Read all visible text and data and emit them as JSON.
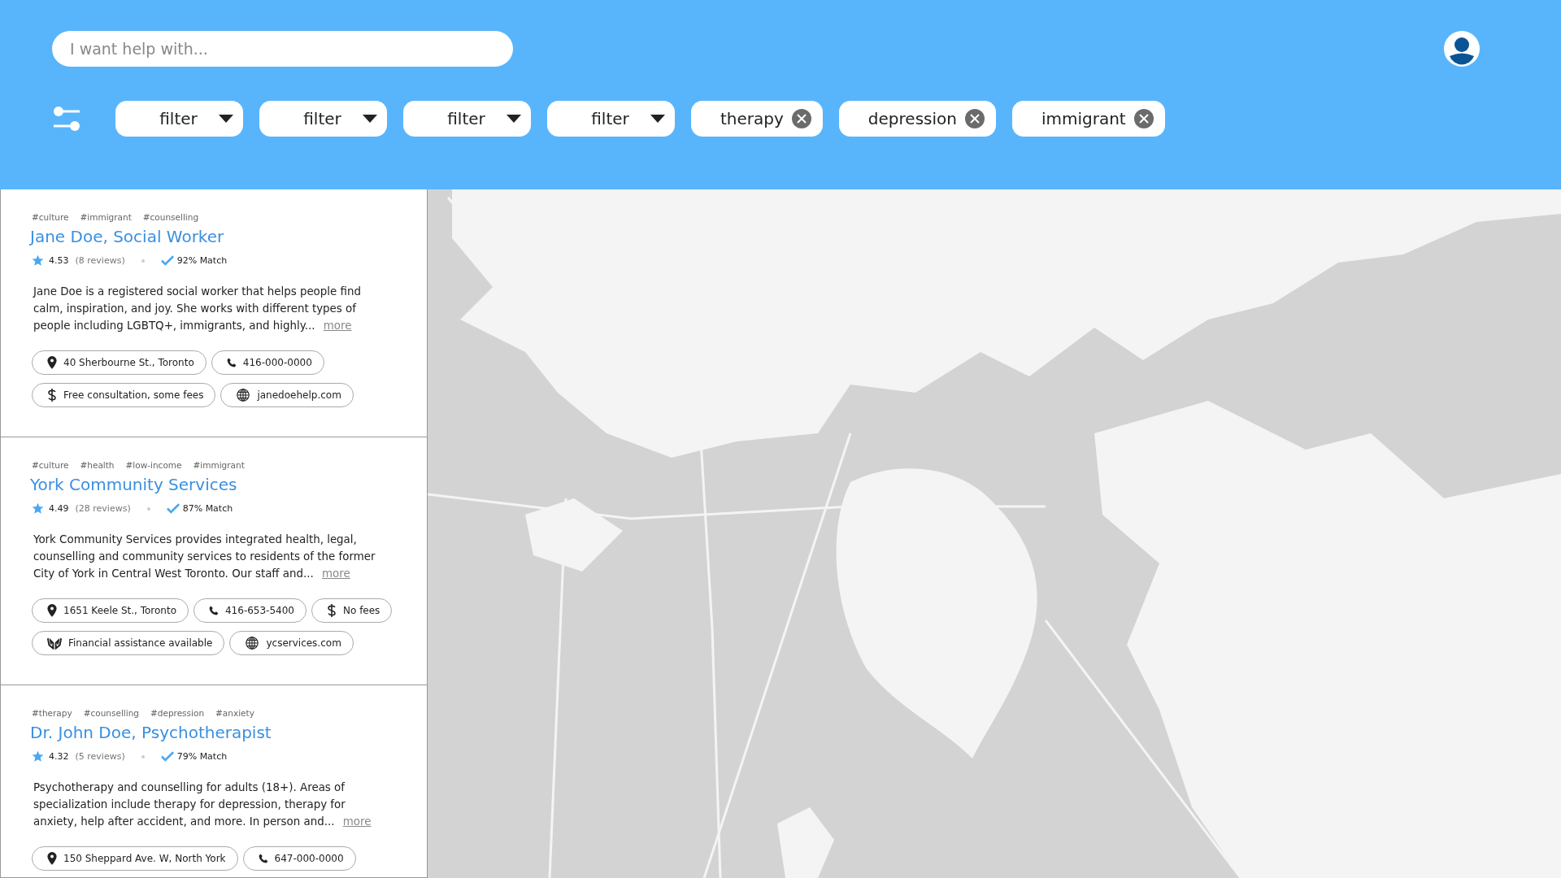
{
  "search": {
    "placeholder": "I want help with..."
  },
  "filters": [
    {
      "kind": "dropdown",
      "label": "filter"
    },
    {
      "kind": "dropdown",
      "label": "filter"
    },
    {
      "kind": "dropdown",
      "label": "filter"
    },
    {
      "kind": "dropdown",
      "label": "filter"
    },
    {
      "kind": "tag",
      "label": "therapy"
    },
    {
      "kind": "tag",
      "label": "depression"
    },
    {
      "kind": "tag",
      "label": "immigrant"
    }
  ],
  "results": [
    {
      "tags": [
        "#culture",
        "#immigrant",
        "#counselling"
      ],
      "name": "Jane Doe, Social Worker",
      "rating": "4.53",
      "reviews": "(8 reviews)",
      "match": "92% Match",
      "description": "Jane Doe is a registered social worker that helps people find calm, inspiration, and joy. She works with different types of people including LGBTQ+, immigrants, and highly...",
      "more": "more",
      "info": [
        {
          "kind": "location",
          "text": "40 Sherbourne St., Toronto"
        },
        {
          "kind": "phone",
          "text": "416-000-0000"
        },
        {
          "kind": "break"
        },
        {
          "kind": "fee",
          "text": "Free consultation, some fees"
        },
        {
          "kind": "web",
          "text": "janedoehelp.com"
        }
      ]
    },
    {
      "tags": [
        "#culture",
        "#health",
        "#low-income",
        "#immigrant"
      ],
      "name": "York Community Services",
      "rating": "4.49",
      "reviews": "(28 reviews)",
      "match": "87% Match",
      "description": "York Community Services provides integrated health, legal, counselling and community services to residents of the former City of York in Central West Toronto. Our staff and...",
      "more": "more",
      "info": [
        {
          "kind": "location",
          "text": "1651 Keele St., Toronto"
        },
        {
          "kind": "phone",
          "text": "416-653-5400"
        },
        {
          "kind": "fee",
          "text": "No fees"
        },
        {
          "kind": "break"
        },
        {
          "kind": "assistance",
          "text": "Financial assistance available"
        },
        {
          "kind": "web",
          "text": "ycservices.com"
        }
      ]
    },
    {
      "tags": [
        "#therapy",
        "#counselling",
        "#depression",
        "#anxiety"
      ],
      "name": "Dr. John Doe, Psychotherapist",
      "rating": "4.32",
      "reviews": "(5 reviews)",
      "match": "79% Match",
      "description": "Psychotherapy and counselling for adults (18+). Areas of specialization include therapy for depression, therapy for anxiety, help after accident, and more. In person and...",
      "more": "more",
      "info": [
        {
          "kind": "location",
          "text": "150 Sheppard Ave. W, North York"
        },
        {
          "kind": "phone",
          "text": "647-000-0000"
        }
      ]
    }
  ]
}
